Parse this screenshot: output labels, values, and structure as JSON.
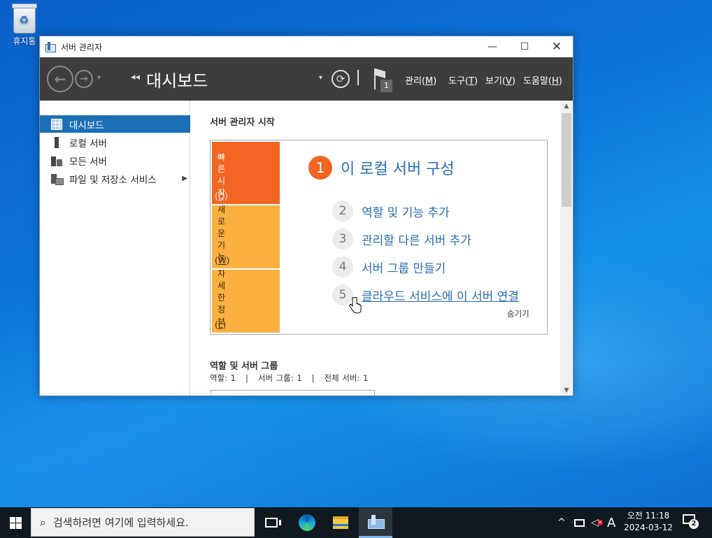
{
  "desktop": {
    "recycle_bin_label": "휴지통"
  },
  "window": {
    "title": "서버 관리자",
    "controls": {
      "minimize": "—",
      "maximize": "☐",
      "close": "✕"
    }
  },
  "toolbar": {
    "back": "←",
    "forward": "→",
    "dropdown": "▾",
    "breadcrumb_arrows": "◂◂",
    "page_title": "대시보드",
    "refresh_dropdown": "▾",
    "refresh": "⟳",
    "flag_count": "1",
    "menus": [
      {
        "label": "관리",
        "mnemonic": "M"
      },
      {
        "label": "도구",
        "mnemonic": "T"
      },
      {
        "label": "보기",
        "mnemonic": "V"
      },
      {
        "label": "도움말",
        "mnemonic": "H"
      }
    ]
  },
  "sidebar": {
    "items": [
      {
        "label": "대시보드",
        "icon": "dashboard-icon",
        "active": true
      },
      {
        "label": "로컬 서버",
        "icon": "local-server-icon"
      },
      {
        "label": "모든 서버",
        "icon": "all-servers-icon"
      },
      {
        "label": "파일 및 저장소 서비스",
        "icon": "file-storage-icon",
        "has_submenu": true
      }
    ],
    "submenu_arrow": "▶"
  },
  "main": {
    "section_title": "서버 관리자 시작",
    "tiles": [
      {
        "label": "빠른 시작",
        "mnemonic": "Q"
      },
      {
        "label": "새로운 기능",
        "mnemonic": "W"
      },
      {
        "label": "자세한 정보",
        "mnemonic": "L"
      }
    ],
    "step1": {
      "num": "1",
      "text": "이 로컬 서버 구성"
    },
    "steps": [
      {
        "num": "2",
        "text": "역할 및 기능 추가"
      },
      {
        "num": "3",
        "text": "관리할 다른 서버 추가"
      },
      {
        "num": "4",
        "text": "서버 그룹 만들기"
      },
      {
        "num": "5",
        "text": "클라우드 서비스에 이 서버 연결"
      }
    ],
    "hide_label": "숨기기",
    "roles_title": "역할 및 서버 그룹",
    "roles_stats": "역할: 1   |   서버 그룹: 1   |   전체 서버: 1"
  },
  "taskbar": {
    "search_placeholder": "검색하려면 여기에 입력하세요.",
    "ime_indicator": "A",
    "tray_up": "^",
    "clock_time": "오전 11:18",
    "clock_date": "2024-03-12",
    "notification_count": "2"
  },
  "colors": {
    "accent_blue": "#1c6fb5",
    "quick_start_orange": "#f26522",
    "tile_yellow": "#fbb040",
    "toolbar_dark": "#3d3d3d",
    "link_blue": "#2a6eb0"
  }
}
